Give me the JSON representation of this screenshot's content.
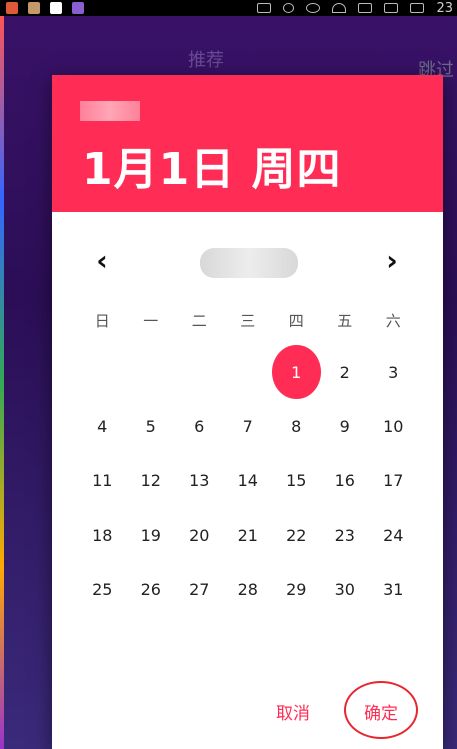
{
  "background": {
    "title": "推荐",
    "skip_label": "跳过"
  },
  "status_bar": {
    "time": "23"
  },
  "dialog": {
    "header": {
      "date_label": "1月1日 周四"
    },
    "nav": {
      "prev_icon": "chevron-left-icon",
      "next_icon": "chevron-right-icon"
    },
    "weekdays": [
      "日",
      "一",
      "二",
      "三",
      "四",
      "五",
      "六"
    ],
    "leading_blank_days": 4,
    "days": [
      "1",
      "2",
      "3",
      "4",
      "5",
      "6",
      "7",
      "8",
      "9",
      "10",
      "11",
      "12",
      "13",
      "14",
      "15",
      "16",
      "17",
      "18",
      "19",
      "20",
      "21",
      "22",
      "23",
      "24",
      "25",
      "26",
      "27",
      "28",
      "29",
      "30",
      "31"
    ],
    "selected_day": "1",
    "actions": {
      "cancel_label": "取消",
      "ok_label": "确定"
    },
    "annotation_color": "#e8262f",
    "accent_color": "#ff2d55"
  }
}
